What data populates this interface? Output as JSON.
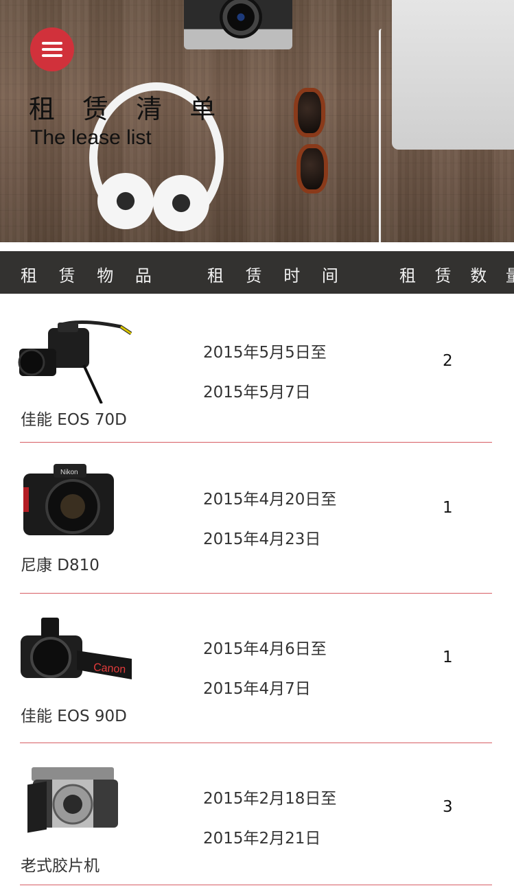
{
  "hero": {
    "title": "租 赁 清 单",
    "subtitle": "The lease list",
    "accent_color": "#d1313b",
    "menu_icon": "menu-icon"
  },
  "table_header": {
    "item": "租 赁 物 品",
    "time": "租 赁 时 间",
    "quantity": "租 赁 数 量"
  },
  "rows": [
    {
      "name": "佳能 EOS 70D",
      "start": "2015年5月5日至",
      "end": "2015年5月7日",
      "quantity": "2",
      "image": "camera-icon"
    },
    {
      "name": "尼康 D810",
      "start": "2015年4月20日至",
      "end": "2015年4月23日",
      "quantity": "1",
      "image": "camera-icon"
    },
    {
      "name": "佳能 EOS 90D",
      "start": "2015年4月6日至",
      "end": "2015年4月7日",
      "quantity": "1",
      "image": "camera-icon"
    },
    {
      "name": "老式胶片机",
      "start": "2015年2月18日至",
      "end": "2015年2月21日",
      "quantity": "3",
      "image": "film-camera-icon"
    }
  ],
  "colors": {
    "header_bg": "#333230",
    "divider": "#d75c63"
  }
}
